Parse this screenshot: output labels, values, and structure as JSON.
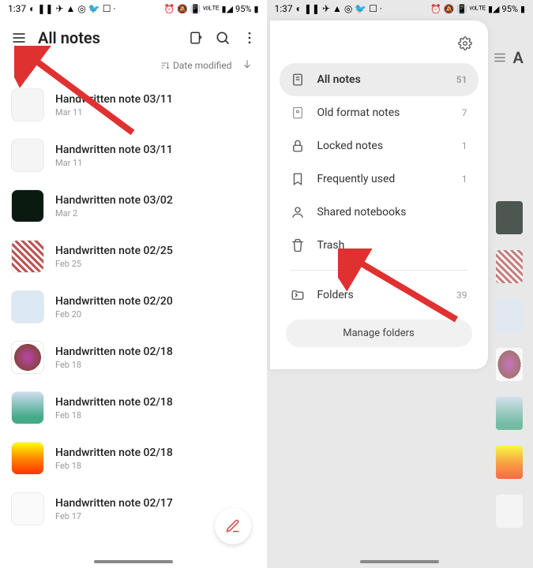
{
  "statusBar": {
    "time": "1:37",
    "battery": "95%"
  },
  "left": {
    "title": "All notes",
    "sortLabel": "Date modified",
    "notes": [
      {
        "title": "Handwritten note 03/11",
        "date": "Mar 11"
      },
      {
        "title": "Handwritten note 03/11",
        "date": "Mar 11"
      },
      {
        "title": "Handwritten note 03/02",
        "date": "Mar 2"
      },
      {
        "title": "Handwritten note 02/25",
        "date": "Feb 25"
      },
      {
        "title": "Handwritten note 02/20",
        "date": "Feb 20"
      },
      {
        "title": "Handwritten note 02/18",
        "date": "Feb 18"
      },
      {
        "title": "Handwritten note 02/18",
        "date": "Feb 18"
      },
      {
        "title": "Handwritten note 02/18",
        "date": "Feb 18"
      },
      {
        "title": "Handwritten note 02/17",
        "date": "Feb 17"
      }
    ]
  },
  "drawer": {
    "items": [
      {
        "label": "All notes",
        "count": "51"
      },
      {
        "label": "Old format notes",
        "count": "7"
      },
      {
        "label": "Locked notes",
        "count": "1"
      },
      {
        "label": "Frequently used",
        "count": "1"
      },
      {
        "label": "Shared notebooks",
        "count": ""
      },
      {
        "label": "Trash",
        "count": ""
      }
    ],
    "folders": {
      "label": "Folders",
      "count": "39"
    },
    "manageFolders": "Manage folders"
  },
  "rightBehind": {
    "titleFragment": "A"
  }
}
